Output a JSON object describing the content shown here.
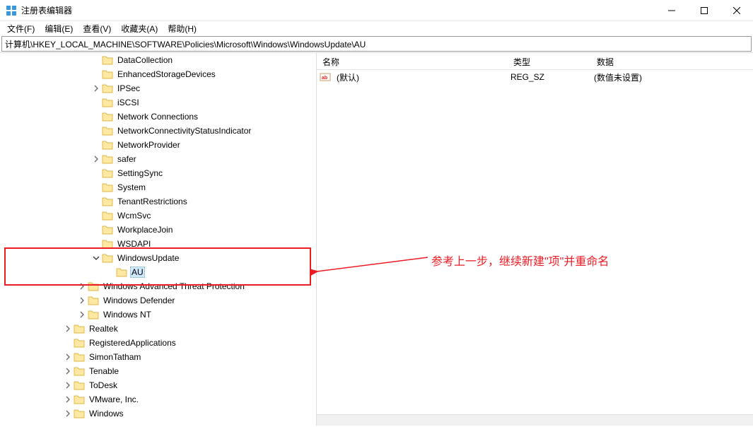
{
  "window": {
    "title": "注册表编辑器"
  },
  "menu": {
    "file": "文件(F)",
    "edit": "编辑(E)",
    "view": "查看(V)",
    "favorites": "收藏夹(A)",
    "help": "帮助(H)"
  },
  "address": "计算机\\HKEY_LOCAL_MACHINE\\SOFTWARE\\Policies\\Microsoft\\Windows\\WindowsUpdate\\AU",
  "tree": [
    {
      "level": 6,
      "exp": "",
      "label": "DataCollection"
    },
    {
      "level": 6,
      "exp": "",
      "label": "EnhancedStorageDevices"
    },
    {
      "level": 6,
      "exp": ">",
      "label": "IPSec"
    },
    {
      "level": 6,
      "exp": "",
      "label": "iSCSI"
    },
    {
      "level": 6,
      "exp": "",
      "label": "Network Connections"
    },
    {
      "level": 6,
      "exp": "",
      "label": "NetworkConnectivityStatusIndicator"
    },
    {
      "level": 6,
      "exp": "",
      "label": "NetworkProvider"
    },
    {
      "level": 6,
      "exp": ">",
      "label": "safer"
    },
    {
      "level": 6,
      "exp": "",
      "label": "SettingSync"
    },
    {
      "level": 6,
      "exp": "",
      "label": "System"
    },
    {
      "level": 6,
      "exp": "",
      "label": "TenantRestrictions"
    },
    {
      "level": 6,
      "exp": "",
      "label": "WcmSvc"
    },
    {
      "level": 6,
      "exp": "",
      "label": "WorkplaceJoin"
    },
    {
      "level": 6,
      "exp": "",
      "label": "WSDAPI"
    },
    {
      "level": 6,
      "exp": "v",
      "label": "WindowsUpdate"
    },
    {
      "level": 7,
      "exp": "",
      "label": "AU",
      "selected": true
    },
    {
      "level": 5,
      "exp": ">",
      "label": "Windows Advanced Threat Protection"
    },
    {
      "level": 5,
      "exp": ">",
      "label": "Windows Defender"
    },
    {
      "level": 5,
      "exp": ">",
      "label": "Windows NT"
    },
    {
      "level": 4,
      "exp": ">",
      "label": "Realtek"
    },
    {
      "level": 4,
      "exp": "",
      "label": "RegisteredApplications"
    },
    {
      "level": 4,
      "exp": ">",
      "label": "SimonTatham"
    },
    {
      "level": 4,
      "exp": ">",
      "label": "Tenable"
    },
    {
      "level": 4,
      "exp": ">",
      "label": "ToDesk"
    },
    {
      "level": 4,
      "exp": ">",
      "label": "VMware, Inc."
    },
    {
      "level": 4,
      "exp": ">",
      "label": "Windows"
    }
  ],
  "columns": {
    "name": "名称",
    "type": "类型",
    "data": "数据"
  },
  "values": [
    {
      "name": "(默认)",
      "type": "REG_SZ",
      "data": "(数值未设置)",
      "kind": "string"
    }
  ],
  "annotation": "参考上一步，继续新建\"项\"并重命名"
}
